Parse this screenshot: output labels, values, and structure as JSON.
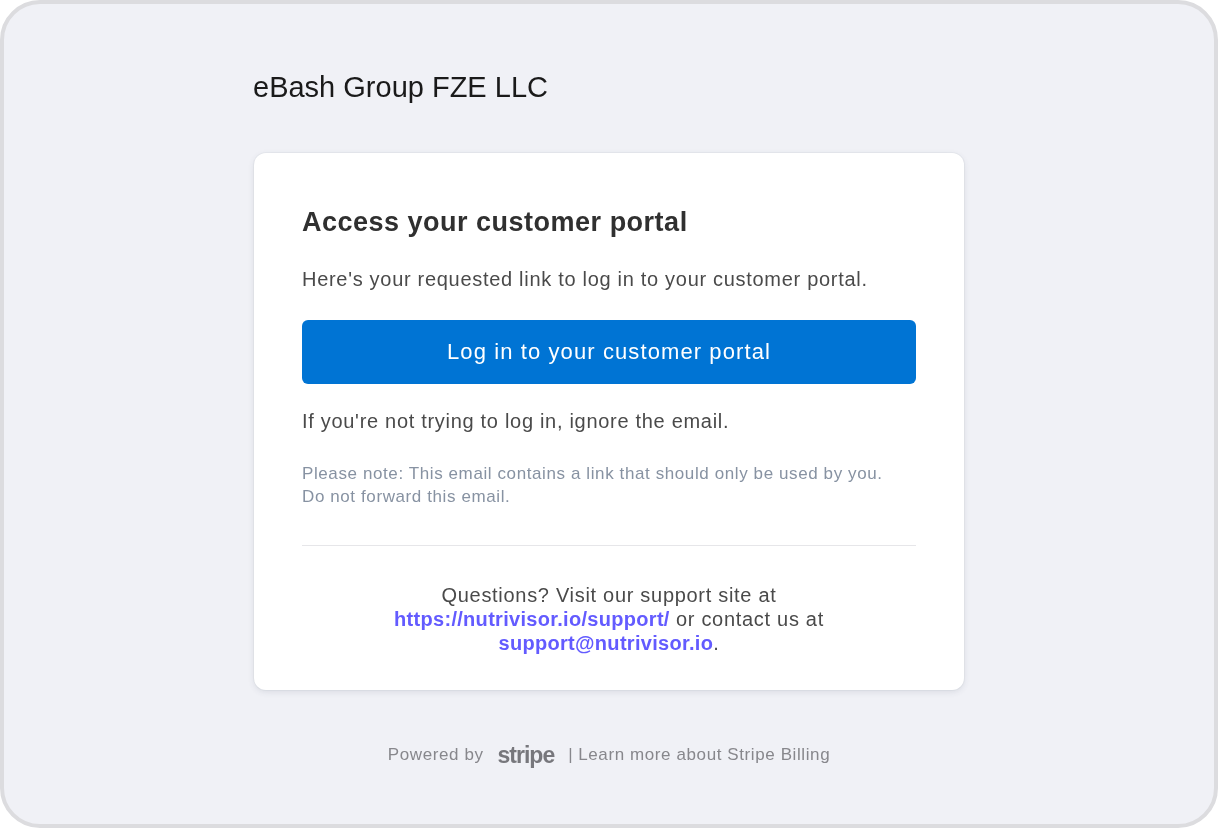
{
  "company_name": "eBash Group FZE LLC",
  "card": {
    "title": "Access your customer portal",
    "intro": "Here's your requested link to log in to your customer portal.",
    "login_button": "Log in to your customer portal",
    "ignore_notice": "If you're not trying to log in, ignore the email.",
    "note": "Please note: This email contains a link that should only be used by you. Do not forward this email.",
    "support": {
      "text_before": "Questions? Visit our support site at",
      "support_link": "https://nutrivisor.io/support/",
      "text_middle": "or contact us at",
      "email_link": "support@nutrivisor.io",
      "text_after": "."
    }
  },
  "footer": {
    "powered_by": "Powered by",
    "logo": "stripe",
    "separator": "|",
    "billing_link": "Learn more about Stripe Billing"
  }
}
